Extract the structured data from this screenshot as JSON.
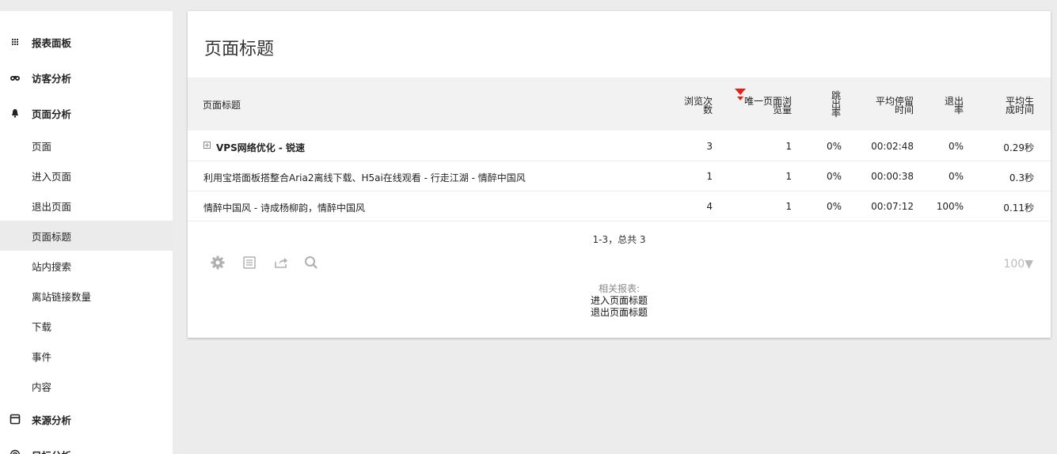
{
  "sidebar": {
    "categories": [
      {
        "label": "报表面板",
        "icon": "grid-icon"
      },
      {
        "label": "访客分析",
        "icon": "binoculars-icon"
      },
      {
        "label": "页面分析",
        "icon": "bell-icon"
      },
      {
        "label": "来源分析",
        "icon": "window-icon"
      },
      {
        "label": "目标分析",
        "icon": "target-icon"
      }
    ],
    "sub_items": [
      {
        "label": "页面"
      },
      {
        "label": "进入页面"
      },
      {
        "label": "退出页面"
      },
      {
        "label": "页面标题",
        "active": true
      },
      {
        "label": "站内搜索"
      },
      {
        "label": "离站链接数量"
      },
      {
        "label": "下载"
      },
      {
        "label": "事件"
      },
      {
        "label": "内容"
      }
    ]
  },
  "report": {
    "title": "页面标题",
    "columns": {
      "label": "页面标题",
      "views": [
        "浏览次",
        "数"
      ],
      "unique": [
        "唯一页面浏",
        "览量"
      ],
      "bounce": [
        "跳",
        "出",
        "率"
      ],
      "avg_time": [
        "平均停留",
        "时间"
      ],
      "exit": [
        "退出",
        "率"
      ],
      "gen_time": [
        "平均生",
        "成时间"
      ]
    },
    "rows": [
      {
        "label": "VPS网络优化 - 锐速",
        "expandable": true,
        "views": "3",
        "unique": "1",
        "bounce": "0%",
        "avg_time": "00:02:48",
        "exit": "0%",
        "gen_time": "0.29秒"
      },
      {
        "label": "利用宝塔面板搭整合Aria2离线下载、H5ai在线观看 - 行走江湖 - 情醉中国风",
        "expandable": false,
        "views": "1",
        "unique": "1",
        "bounce": "0%",
        "avg_time": "00:00:38",
        "exit": "0%",
        "gen_time": "0.3秒"
      },
      {
        "label": "情醉中国风 - 诗成杨柳韵，情醉中国风",
        "expandable": false,
        "views": "4",
        "unique": "1",
        "bounce": "0%",
        "avg_time": "00:07:12",
        "exit": "100%",
        "gen_time": "0.11秒"
      }
    ],
    "pagination": "1-3，总共 3",
    "limit": "100",
    "related": {
      "title": "相关报表:",
      "links": [
        "进入页面标题",
        "退出页面标题"
      ]
    },
    "expand_glyph": "+",
    "limit_arrow": "▼"
  },
  "colors": {
    "sort_indicator": "#d9251f",
    "active_item_bg": "#ebebeb"
  }
}
